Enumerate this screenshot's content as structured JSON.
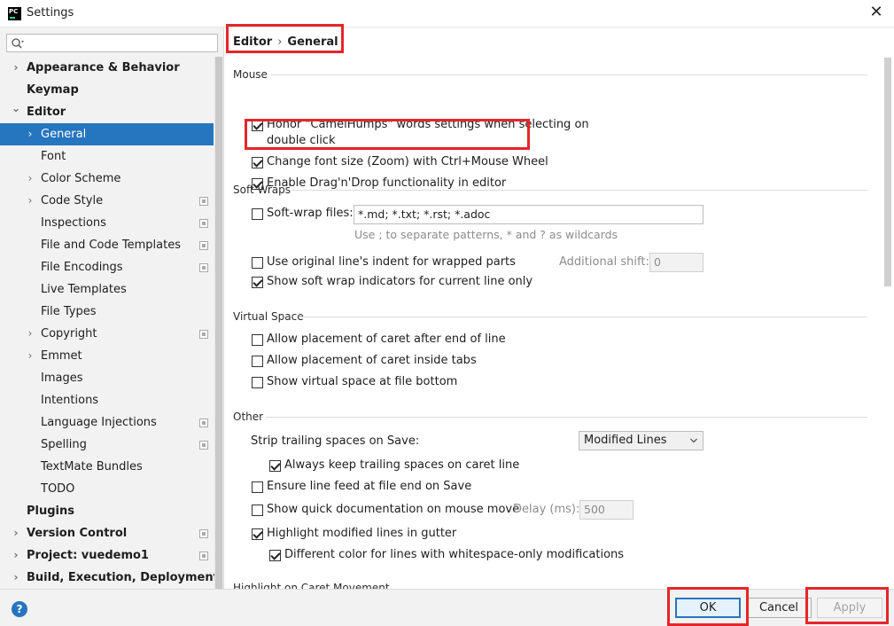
{
  "window": {
    "title": "Settings",
    "app_icon": "PC"
  },
  "search": {
    "placeholder": "",
    "value": ""
  },
  "sidebar": {
    "items": [
      {
        "label": "Appearance & Behavior",
        "level": 0,
        "bold": true,
        "expandable": true,
        "expanded": false,
        "project_icon": false
      },
      {
        "label": "Keymap",
        "level": 0,
        "bold": true,
        "expandable": false,
        "project_icon": false
      },
      {
        "label": "Editor",
        "level": 0,
        "bold": true,
        "expandable": true,
        "expanded": true,
        "project_icon": false
      },
      {
        "label": "General",
        "level": 1,
        "bold": false,
        "expandable": true,
        "expanded": false,
        "selected": true,
        "project_icon": false
      },
      {
        "label": "Font",
        "level": 1,
        "bold": false,
        "expandable": false,
        "project_icon": false
      },
      {
        "label": "Color Scheme",
        "level": 1,
        "bold": false,
        "expandable": true,
        "expanded": false,
        "project_icon": false
      },
      {
        "label": "Code Style",
        "level": 1,
        "bold": false,
        "expandable": true,
        "expanded": false,
        "project_icon": true
      },
      {
        "label": "Inspections",
        "level": 1,
        "bold": false,
        "expandable": false,
        "project_icon": true
      },
      {
        "label": "File and Code Templates",
        "level": 1,
        "bold": false,
        "expandable": false,
        "project_icon": true
      },
      {
        "label": "File Encodings",
        "level": 1,
        "bold": false,
        "expandable": false,
        "project_icon": true
      },
      {
        "label": "Live Templates",
        "level": 1,
        "bold": false,
        "expandable": false,
        "project_icon": false
      },
      {
        "label": "File Types",
        "level": 1,
        "bold": false,
        "expandable": false,
        "project_icon": false
      },
      {
        "label": "Copyright",
        "level": 1,
        "bold": false,
        "expandable": true,
        "expanded": false,
        "project_icon": true
      },
      {
        "label": "Emmet",
        "level": 1,
        "bold": false,
        "expandable": true,
        "expanded": false,
        "project_icon": false
      },
      {
        "label": "Images",
        "level": 1,
        "bold": false,
        "expandable": false,
        "project_icon": false
      },
      {
        "label": "Intentions",
        "level": 1,
        "bold": false,
        "expandable": false,
        "project_icon": false
      },
      {
        "label": "Language Injections",
        "level": 1,
        "bold": false,
        "expandable": false,
        "project_icon": true
      },
      {
        "label": "Spelling",
        "level": 1,
        "bold": false,
        "expandable": false,
        "project_icon": true
      },
      {
        "label": "TextMate Bundles",
        "level": 1,
        "bold": false,
        "expandable": false,
        "project_icon": false
      },
      {
        "label": "TODO",
        "level": 1,
        "bold": false,
        "expandable": false,
        "project_icon": false
      },
      {
        "label": "Plugins",
        "level": 0,
        "bold": true,
        "expandable": false,
        "project_icon": false
      },
      {
        "label": "Version Control",
        "level": 0,
        "bold": true,
        "expandable": true,
        "expanded": false,
        "project_icon": true
      },
      {
        "label": "Project: vuedemo1",
        "level": 0,
        "bold": true,
        "expandable": true,
        "expanded": false,
        "project_icon": true
      },
      {
        "label": "Build, Execution, Deployment",
        "level": 0,
        "bold": true,
        "expandable": true,
        "expanded": false,
        "project_icon": false
      }
    ]
  },
  "breadcrumb": {
    "parent": "Editor",
    "separator": "›",
    "current": "General"
  },
  "sections": {
    "mouse": {
      "title": "Mouse",
      "camelhumps_line1": "Honor \"CamelHumps\" words settings when selecting on",
      "camelhumps_line2": "double click",
      "camelhumps_checked": true,
      "zoom": "Change font size (Zoom) with Ctrl+Mouse Wheel",
      "zoom_checked": true,
      "dragdrop": "Enable Drag'n'Drop functionality in editor",
      "dragdrop_checked": true
    },
    "soft_wraps": {
      "title": "Soft Wraps",
      "softwrap_files": "Soft-wrap files:",
      "softwrap_files_checked": false,
      "softwrap_files_value": "*.md; *.txt; *.rst; *.adoc",
      "softwrap_hint": "Use ; to separate patterns, * and ? as wildcards",
      "original_indent": "Use original line's indent for wrapped parts",
      "original_indent_checked": false,
      "additional_shift_label": "Additional shift:",
      "additional_shift_value": "0",
      "show_indicators": "Show soft wrap indicators for current line only",
      "show_indicators_checked": true
    },
    "virtual_space": {
      "title": "Virtual Space",
      "after_end": "Allow placement of caret after end of line",
      "after_end_checked": false,
      "inside_tabs": "Allow placement of caret inside tabs",
      "inside_tabs_checked": false,
      "file_bottom": "Show virtual space at file bottom",
      "file_bottom_checked": false
    },
    "other": {
      "title": "Other",
      "strip_label": "Strip trailing spaces on Save:",
      "strip_value": "Modified Lines",
      "keep_trailing": "Always keep trailing spaces on caret line",
      "keep_trailing_checked": true,
      "line_feed": "Ensure line feed at file end on Save",
      "line_feed_checked": false,
      "quick_doc": "Show quick documentation on mouse move",
      "quick_doc_checked": false,
      "delay_label": "Delay (ms):",
      "delay_value": "500",
      "highlight_modified": "Highlight modified lines in gutter",
      "highlight_modified_checked": true,
      "different_color": "Different color for lines with whitespace-only modifications",
      "different_color_checked": true
    },
    "next_section_title": "Highlight on Caret Movement"
  },
  "buttons": {
    "ok": "OK",
    "cancel": "Cancel",
    "apply": "Apply",
    "help": "?"
  },
  "colors": {
    "selection": "#2675bf",
    "annotation": "#e5262a",
    "accent": "#2675bf"
  }
}
